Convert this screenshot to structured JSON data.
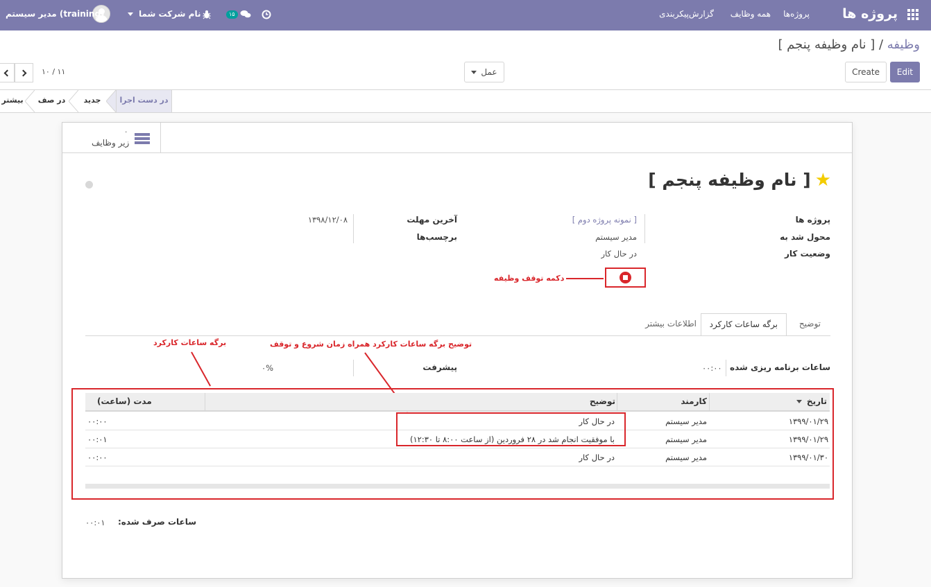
{
  "navbar": {
    "brand": "پروژه ها",
    "menu": [
      "پروژه‌ها",
      "همه وظایف",
      "گزارش",
      "پیکربندی"
    ],
    "company": "نام شرکت شما",
    "user": "مدیر سیستم (training)",
    "messages_count": "۱۵"
  },
  "breadcrumb": {
    "parent": "وظیفه",
    "sep": " / ",
    "current": "[ نام وظیفه پنجم ]"
  },
  "buttons": {
    "edit": "Edit",
    "create": "Create",
    "action": "عمل"
  },
  "pager": "۱۰ / ۱۱",
  "stages": [
    "در دست اجرا",
    "جدید",
    "در صف",
    "بیشتر"
  ],
  "smart_button": {
    "value": "۰",
    "label": "زیر وظایف"
  },
  "task": {
    "title": "[ نام وظیفه پنجم ]",
    "starred": true
  },
  "fields": {
    "project_label": "پروژه ها",
    "project_value": "[ نمونه پروژه دوم ]",
    "assigned_label": "محول شد به",
    "assigned_value": "مدیر سیستم",
    "status_label": "وضعیت کار",
    "status_value": "در حال کار",
    "deadline_label": "آخرین مهلت",
    "deadline_value": "۱۳۹۸/۱۲/۰۸",
    "tags_label": "برچسب‌ها"
  },
  "tabs": [
    "توضیح",
    "برگه ساعات کارکرد",
    "اطلاعات بیشتر"
  ],
  "active_tab": "برگه ساعات کارکرد",
  "timesheet": {
    "planned_label": "ساعات برنامه ریزی شده",
    "planned_value": "۰۰:۰۰",
    "progress_label": "پیشرفت",
    "progress_value": "۰%",
    "columns": [
      "تاریخ",
      "کارمند",
      "توضیح",
      "مدت (ساعت)"
    ],
    "rows": [
      {
        "date": "۱۳۹۹/۰۱/۲۹",
        "employee": "مدیر سیستم",
        "description": "در حال کار",
        "duration": "۰۰:۰۰"
      },
      {
        "date": "۱۳۹۹/۰۱/۲۹",
        "employee": "مدیر سیستم",
        "description": "با موفقیت انجام شد در ۲۸ فروردین (از ساعت ۸:۰۰ تا ۱۲:۳۰)",
        "duration": "۰۰:۰۱"
      },
      {
        "date": "۱۳۹۹/۰۱/۳۰",
        "employee": "مدیر سیستم",
        "description": "در حال کار",
        "duration": "۰۰:۰۰"
      }
    ],
    "spent_label": "ساعات صرف شده:",
    "spent_value": "۰۰:۰۱"
  },
  "annotations": {
    "stop_button": "دکمه توقف وظیفه",
    "timesheet": "برگه ساعات کارکرد",
    "description": "توضیح برگه ساعات کارکرد همراه زمان شروع و توقف"
  },
  "colors": {
    "brand": "#7c7bad",
    "annotation": "#d9262b",
    "star": "#f3cc00"
  }
}
